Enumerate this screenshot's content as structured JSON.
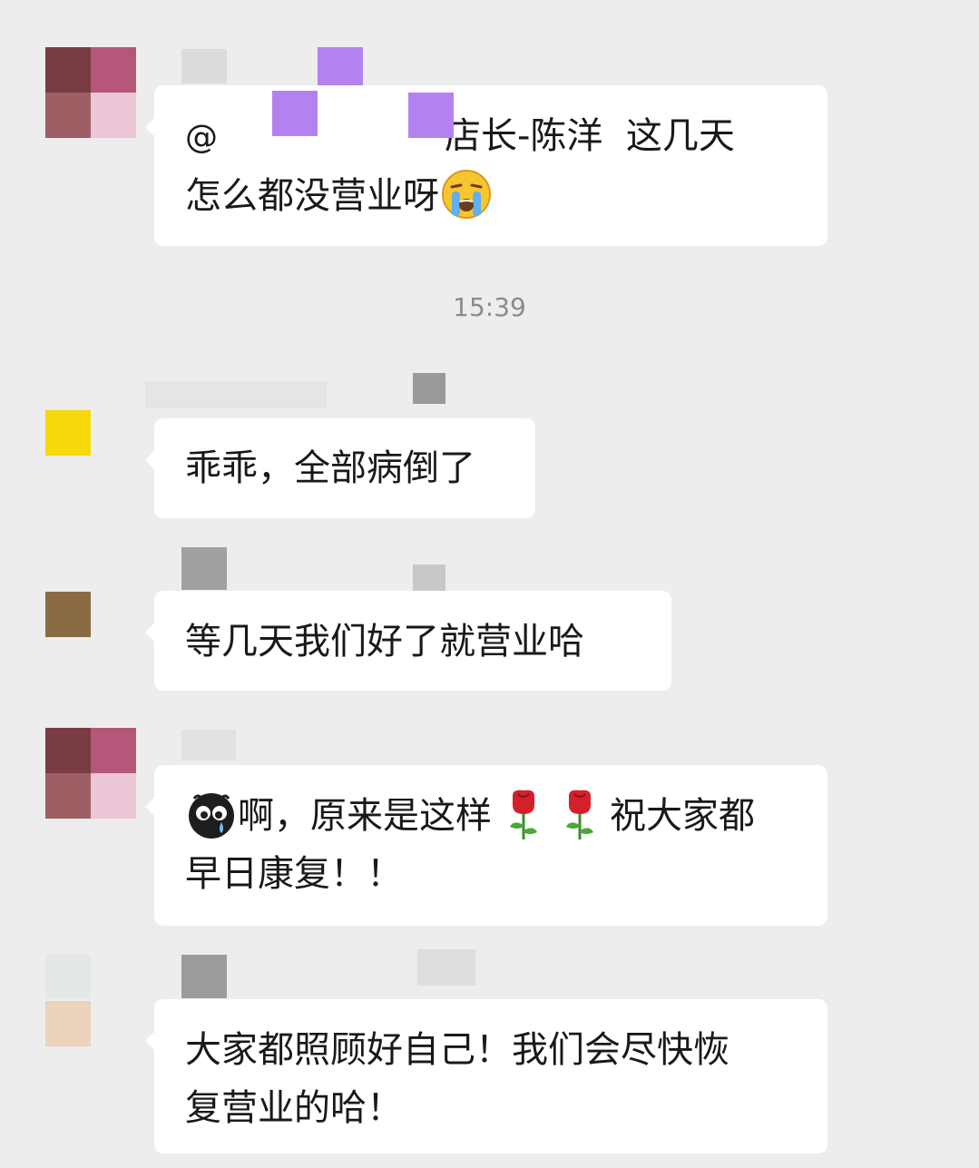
{
  "messages": [
    {
      "mention_prefix": "@",
      "mention_name": "店长-陈洋",
      "line1_rest": "  这几天",
      "line2": "怎么都没营业呀",
      "emoji": "crying-face-icon"
    },
    {
      "text": "乖乖，全部病倒了"
    },
    {
      "text": "等几天我们好了就营业哈"
    },
    {
      "line1_text": "啊，原来是这样",
      "line1_rest": "祝大家都",
      "line2": "早日康复！！",
      "emojis": [
        "sad-ball-icon",
        "rose-icon",
        "rose-icon"
      ]
    },
    {
      "line1": "大家都照顾好自己！我们会尽快恢",
      "line2": "复营业的哈！"
    }
  ],
  "timestamp": "15:39",
  "colors": {
    "background": "#ededed",
    "bubble": "#ffffff",
    "text": "#191919",
    "timestamp": "#8c8c8c"
  }
}
